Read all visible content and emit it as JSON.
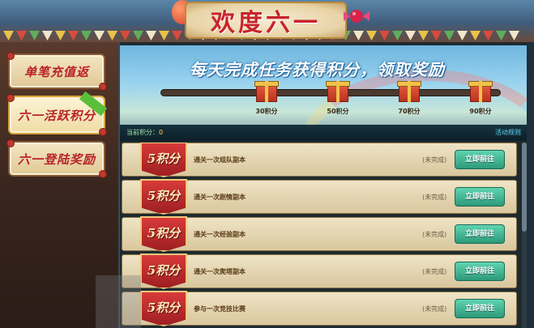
{
  "header": {
    "title": "欢度六一"
  },
  "sidebar": {
    "items": [
      {
        "label": "单笔充值返",
        "active": false
      },
      {
        "label": "六一活跃积分",
        "active": true,
        "ribbon": ""
      },
      {
        "label": "六一登陆奖励",
        "active": false
      }
    ]
  },
  "banner": {
    "title": "每天完成任务获得积分，领取奖励",
    "milestones": [
      {
        "label": "30积分"
      },
      {
        "label": "50积分"
      },
      {
        "label": "70积分"
      },
      {
        "label": "90积分"
      }
    ],
    "current_points_label": "当前积分：",
    "current_points_value": "0",
    "rules_link": "活动规则"
  },
  "tasks": [
    {
      "points": "5积分",
      "desc": "通关一次组队副本",
      "status": "(未完成)",
      "button": "立即前往"
    },
    {
      "points": "5积分",
      "desc": "通关一次剧情副本",
      "status": "(未完成)",
      "button": "立即前往"
    },
    {
      "points": "5积分",
      "desc": "通关一次经验副本",
      "status": "(未完成)",
      "button": "立即前往"
    },
    {
      "points": "5积分",
      "desc": "通关一次爬塔副本",
      "status": "(未完成)",
      "button": "立即前往"
    },
    {
      "points": "5积分",
      "desc": "参与一次竞技比赛",
      "status": "(未完成)",
      "button": "立即前往"
    }
  ],
  "colors": {
    "accent_red": "#c8242c",
    "button_green": "#2c9a7a",
    "points_yellow": "#ffd34d",
    "link_cyan": "#5fd9ff"
  }
}
